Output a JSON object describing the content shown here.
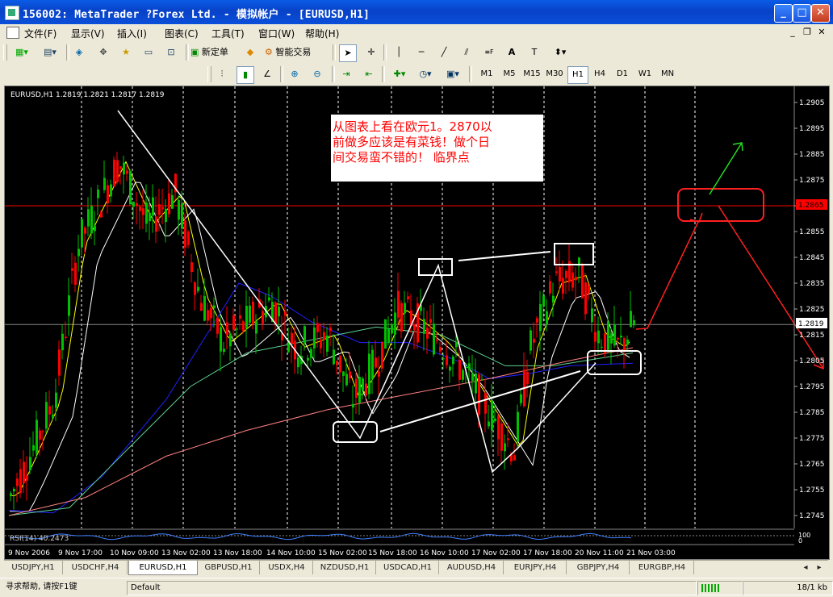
{
  "window": {
    "title": "156002: MetaTrader ?Forex Ltd. - 模拟帐户 - [EURUSD,H1]",
    "min_label": "_",
    "max_label": "□",
    "close_label": "✕"
  },
  "menu": [
    {
      "label": "文件(F)"
    },
    {
      "label": "显示(V)"
    },
    {
      "label": "插入(I)"
    },
    {
      "label": "图表(C)"
    },
    {
      "label": "工具(T)"
    },
    {
      "label": "窗口(W)"
    },
    {
      "label": "帮助(H)"
    }
  ],
  "toolbar": {
    "new_order": "新定单",
    "expert": "智能交易"
  },
  "timeframes": [
    "M1",
    "M5",
    "M15",
    "M30",
    "H1",
    "H4",
    "D1",
    "W1",
    "MN"
  ],
  "active_timeframe": "H1",
  "chart": {
    "info": "EURUSD,H1  1.2819 1.2821 1.2817 1.2819",
    "annotation_lines": [
      "从图表上看在欧元1。2870以",
      "前做多应该是有菜钱！做个日",
      "间交易蛮不错的！   临界点"
    ],
    "price_labels": [
      "1.2905",
      "1.2895",
      "1.2885",
      "1.2875",
      "1.2865",
      "1.2855",
      "1.2845",
      "1.2835",
      "1.2825",
      "1.2815",
      "1.2805",
      "1.2795",
      "1.2785",
      "1.2775",
      "1.2765",
      "1.2755",
      "1.2745"
    ],
    "red_level_label": "1.2865",
    "current_price_label": "1.2819",
    "time_labels": [
      "9 Nov 2006",
      "9 Nov 17:00",
      "10 Nov 09:00",
      "13 Nov 02:00",
      "13 Nov 18:00",
      "14 Nov 10:00",
      "15 Nov 02:00",
      "15 Nov 18:00",
      "16 Nov 10:00",
      "17 Nov 02:00",
      "17 Nov 18:00",
      "20 Nov 11:00",
      "21 Nov 03:00"
    ],
    "rsi_label": "RSI(14) 40.2473",
    "rsi_scale": [
      "100",
      "0"
    ]
  },
  "tabs": [
    "USDJPY,H1",
    "USDCHF,H4",
    "EURUSD,H1",
    "GBPUSD,H1",
    "USDX,H4",
    "NZDUSD,H1",
    "USDCAD,H1",
    "AUDUSD,H4",
    "EURJPY,H4",
    "GBPJPY,H4",
    "EURGBP,H4"
  ],
  "active_tab": "EURUSD,H1",
  "status": {
    "help": "寻求帮助, 请按F1键",
    "profile": "Default",
    "traffic": "18/1 kb"
  },
  "colors": {
    "titlebar": "#0a4fd9",
    "chart_bg": "#000000",
    "bull_candle": "#00c000",
    "bear_candle": "#ff0000",
    "resistance": "#ff0000",
    "ma_fast": "#ffff00",
    "ma_white": "#ffffff",
    "ma_blue": "#2020ff",
    "ma_green": "#5fd08f",
    "ma_pink": "#ff8080"
  }
}
